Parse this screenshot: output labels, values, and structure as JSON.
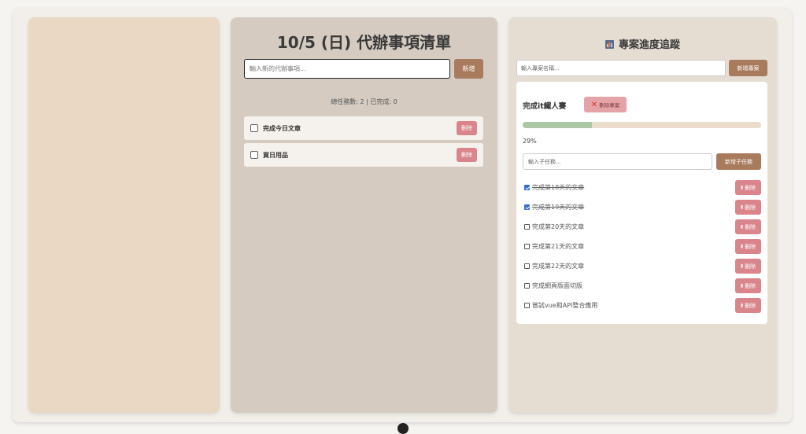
{
  "todo": {
    "title": "10/5 (日) 代辦事項清單",
    "input_placeholder": "輸入新的代辦事項...",
    "add_label": "新增",
    "stats": "總任務數: 2 | 已完成: 0",
    "items": [
      {
        "label": "完成今日文章",
        "done": false,
        "delete_label": "刪除"
      },
      {
        "label": "買日用品",
        "done": false,
        "delete_label": "刪除"
      }
    ]
  },
  "projects": {
    "title": "專案進度追蹤",
    "title_icon": "bar-chart-icon",
    "input_placeholder": "輸入專案名稱...",
    "add_label": "新增專案",
    "project": {
      "name": "完成it鐵人賽",
      "delete_label": "刪除專案",
      "progress_percent": 29,
      "progress_text": "29%",
      "subtask_placeholder": "輸入子任務...",
      "subtask_add_label": "新增子任務",
      "subtasks": [
        {
          "label": "完成第18天的文章",
          "done": true,
          "delete_label": "刪除"
        },
        {
          "label": "完成第19天的文章",
          "done": true,
          "delete_label": "刪除"
        },
        {
          "label": "完成第20天的文章",
          "done": false,
          "delete_label": "刪除"
        },
        {
          "label": "完成第21天的文章",
          "done": false,
          "delete_label": "刪除"
        },
        {
          "label": "完成第22天的文章",
          "done": false,
          "delete_label": "刪除"
        },
        {
          "label": "完成網頁版面切版",
          "done": false,
          "delete_label": "刪除"
        },
        {
          "label": "嘗試vue和API整合應用",
          "done": false,
          "delete_label": "刪除"
        }
      ]
    }
  },
  "colors": {
    "accent_brown": "#a97b5d",
    "delete_pink": "#d9858b",
    "progress_green": "#adc6a5",
    "progress_track": "#ecdccb"
  }
}
